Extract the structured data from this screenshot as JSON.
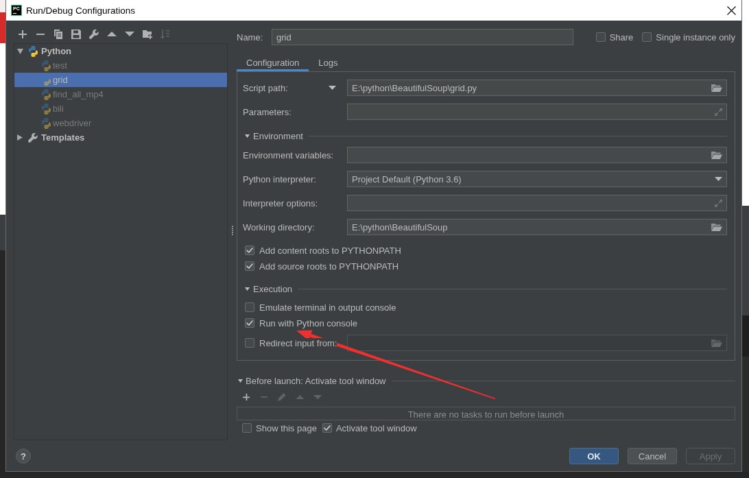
{
  "window": {
    "app_icon_label": "PC",
    "title": "Run/Debug Configurations"
  },
  "sidebar": {
    "toolbar": [
      {
        "kind": "add",
        "disabled": false
      },
      {
        "kind": "remove",
        "disabled": false
      },
      {
        "kind": "copy",
        "disabled": false
      },
      {
        "kind": "save",
        "disabled": false
      },
      {
        "kind": "edit",
        "disabled": false
      },
      {
        "kind": "move_up",
        "disabled": false
      },
      {
        "kind": "move_down",
        "disabled": false
      },
      {
        "kind": "new_folder",
        "disabled": false
      },
      {
        "kind": "sort",
        "disabled": true
      }
    ],
    "tree": [
      {
        "kind": "python",
        "label": "Python",
        "expanded": true,
        "selected": false,
        "children": [
          {
            "kind": "python",
            "label": "test",
            "selected": false,
            "temporary": true
          },
          {
            "kind": "python",
            "label": "grid",
            "selected": true,
            "temporary": true
          },
          {
            "kind": "python",
            "label": "find_all_mp4",
            "selected": false,
            "temporary": true
          },
          {
            "kind": "python",
            "label": "bili",
            "selected": false,
            "temporary": true
          },
          {
            "kind": "python",
            "label": "webdriver",
            "selected": false,
            "temporary": true
          }
        ]
      },
      {
        "kind": "templates",
        "label": "Templates",
        "expanded": false,
        "selected": false
      }
    ]
  },
  "name_field": {
    "label": "Name:",
    "value": "grid"
  },
  "options": [
    {
      "label": "Share",
      "checked": false
    },
    {
      "label": "Single instance only",
      "checked": false
    }
  ],
  "tabs": [
    {
      "label": "Configuration",
      "selected": true
    },
    {
      "label": "Logs",
      "selected": false
    }
  ],
  "configuration": {
    "rows": [
      {
        "kind": "field",
        "label": "Script path:",
        "selector": true,
        "value": "E:\\python\\BeautifulSoup\\grid.py",
        "browse_button": true,
        "disabled": false
      },
      {
        "kind": "field",
        "label": "Parameters:",
        "selector": false,
        "expand_button": true,
        "disabled": false
      },
      {
        "kind": "section",
        "label": "Environment",
        "expanded": true
      },
      {
        "kind": "field",
        "label": "Environment variables:",
        "selector": false,
        "browse_button": true,
        "disabled": false
      },
      {
        "kind": "combo",
        "label": "Python interpreter:",
        "value": "Project Default (Python 3.6)",
        "disabled": false
      },
      {
        "kind": "field",
        "label": "Interpreter options:",
        "selector": false,
        "expand_button": true,
        "disabled": false
      },
      {
        "kind": "field",
        "label": "Working directory:",
        "selector": false,
        "value": "E:\\python\\BeautifulSoup",
        "browse_button": true,
        "disabled": false
      },
      {
        "kind": "checkbox",
        "label": "Add content roots to PYTHONPATH",
        "checked": true
      },
      {
        "kind": "checkbox",
        "label": "Add source roots to PYTHONPATH",
        "checked": true
      },
      {
        "kind": "section",
        "label": "Execution",
        "expanded": true
      },
      {
        "kind": "checkbox",
        "label": "Emulate terminal in output console",
        "checked": false
      },
      {
        "kind": "checkbox",
        "label": "Run with Python console",
        "checked": true
      },
      {
        "kind": "checkbox_field",
        "label": "Redirect input from:",
        "checked": false,
        "browse_button": true,
        "disabled": true
      }
    ]
  },
  "before_launch": {
    "label": "Before launch: Activate tool window",
    "expanded": true,
    "toolbar": [
      {
        "kind": "add",
        "disabled": false
      },
      {
        "kind": "remove",
        "disabled": true
      },
      {
        "kind": "pencil",
        "disabled": true
      },
      {
        "kind": "move_up",
        "disabled": true
      },
      {
        "kind": "move_down",
        "disabled": true
      }
    ],
    "empty_text": "There are no tasks to run before launch",
    "options": [
      {
        "label": "Show this page",
        "checked": false
      },
      {
        "label": "Activate tool window",
        "checked": true
      }
    ]
  },
  "footer": {
    "help": {
      "label": "?"
    },
    "buttons": [
      {
        "label": "OK",
        "kind": "default",
        "disabled": false
      },
      {
        "label": "Cancel",
        "kind": "normal",
        "disabled": false
      },
      {
        "label": "Apply",
        "kind": "normal",
        "disabled": true
      }
    ]
  }
}
